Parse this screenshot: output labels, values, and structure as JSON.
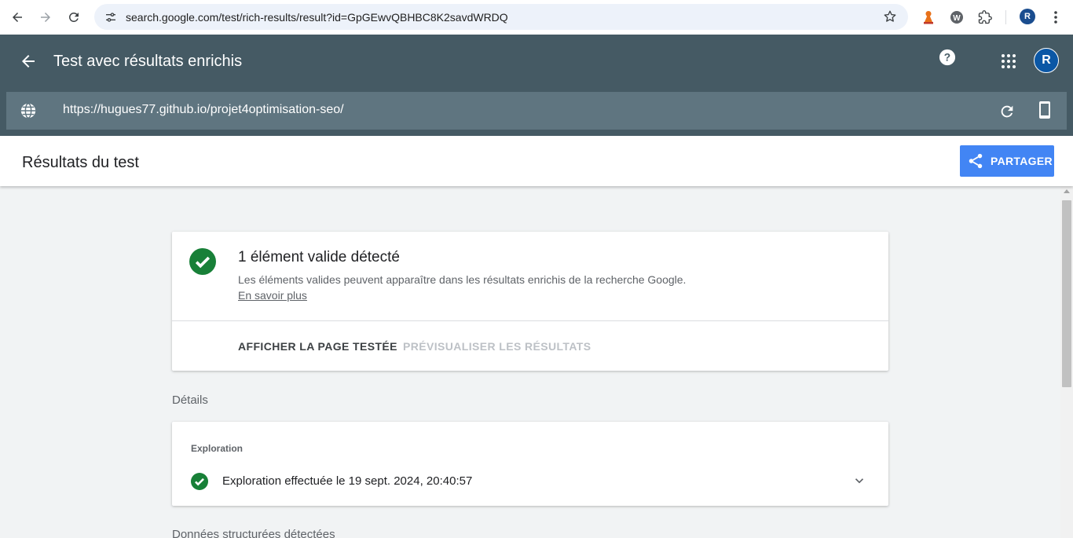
{
  "browser": {
    "url": "search.google.com/test/rich-results/result?id=GpGEwvQBHBC8K2savdWRDQ",
    "profile_initial": "R"
  },
  "header": {
    "title": "Test avec résultats enrichis",
    "avatar_initial": "R",
    "tested_url": "https://hugues77.github.io/projet4optimisation-seo/"
  },
  "results": {
    "title": "Résultats du test",
    "share_label": "PARTAGER"
  },
  "summary": {
    "title": "1 élément valide détecté",
    "description": "Les éléments valides peuvent apparaître dans les résultats enrichis de la recherche Google.",
    "learn_more": "En savoir plus",
    "view_page_label": "AFFICHER LA PAGE TESTÉE",
    "preview_label": "PRÉVISUALISER LES RÉSULTATS"
  },
  "details": {
    "label": "Détails",
    "exploration_heading": "Exploration",
    "exploration_text": "Exploration effectuée le 19 sept. 2024, 20:40:57",
    "structured_label": "Données structurées détectées"
  },
  "colors": {
    "header_bg": "#455a64",
    "url_bar_bg": "#5f7580",
    "share_button": "#4285f4",
    "success_green": "#188038"
  },
  "icons": [
    "back-arrow-icon",
    "forward-arrow-icon",
    "reload-icon",
    "site-info-icon",
    "star-icon",
    "extensions-icon",
    "help-icon",
    "apps-icon",
    "globe-icon",
    "mobile-icon",
    "share-icon",
    "check-circle-icon",
    "chevron-down-icon"
  ]
}
